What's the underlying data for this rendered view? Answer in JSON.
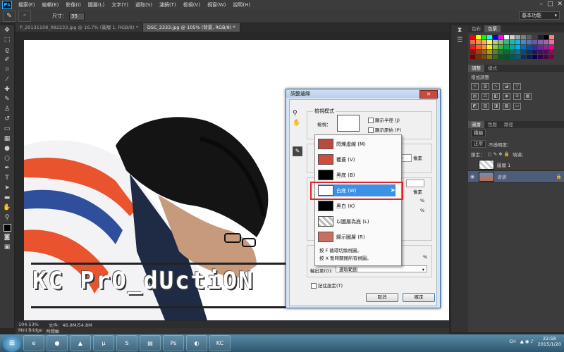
{
  "menubar": {
    "items": [
      "檔案(F)",
      "編輯(E)",
      "影像(I)",
      "圖層(L)",
      "文字(Y)",
      "選取(S)",
      "濾鏡(T)",
      "檢視(V)",
      "視窗(W)",
      "說明(H)"
    ],
    "app_icon": "Ps"
  },
  "options": {
    "size_label": "尺寸：",
    "size_value": "35",
    "workspace": "基本功能"
  },
  "tabs": [
    {
      "label": "P_20131108_082233.jpg @ 16.7% (圖層 1, RGB/8) *"
    },
    {
      "label": "DSC_2333.jpg @ 105% (背景, RGB/8) *"
    }
  ],
  "canvas": {
    "watermark": "KC PrO_dUctiON"
  },
  "status": {
    "zoom": "104.53%",
    "doc": "文件：46.8M/54.8M"
  },
  "bottom_tabs": [
    "Mini Bridge",
    "時間軸"
  ],
  "panels": {
    "color_tabs": [
      "色彩",
      "色票"
    ],
    "swatch_colors": [
      "#ff0000",
      "#ffff00",
      "#00ff00",
      "#00ffff",
      "#0000ff",
      "#ff00ff",
      "#ffffff",
      "#d0d0d0",
      "#a0a0a0",
      "#808080",
      "#606060",
      "#404040",
      "#202020",
      "#000000",
      "#ff8080",
      "#f26c4f",
      "#f68e55",
      "#fbaf5c",
      "#fff467",
      "#acd372",
      "#7cc576",
      "#3bb878",
      "#1abbb4",
      "#00bff3",
      "#438ccb",
      "#5574b9",
      "#605ca8",
      "#855fa8",
      "#a763a8",
      "#f06ea9",
      "#ed1c24",
      "#f26522",
      "#f7941d",
      "#fff200",
      "#8dc63f",
      "#39b54a",
      "#00a651",
      "#00a99d",
      "#00aeef",
      "#0072bc",
      "#0054a6",
      "#2e3192",
      "#662d91",
      "#92278f",
      "#ec008c",
      "#9e0b0f",
      "#a0410d",
      "#a36209",
      "#aba000",
      "#598527",
      "#1a7b30",
      "#007236",
      "#00746b",
      "#0076a3",
      "#004b80",
      "#003471",
      "#1b1464",
      "#440e62",
      "#630460",
      "#9e005d",
      "#790000",
      "#7b2e00",
      "#7d4900",
      "#827b00",
      "#406618",
      "#005e20",
      "#005826",
      "#005952",
      "#005b7f",
      "#003663",
      "#002157",
      "#0d004c",
      "#32004b",
      "#4b0049",
      "#7b0046"
    ],
    "adjust_tabs": [
      "調整",
      "樣式"
    ],
    "adjust_title": "增加調整",
    "layer_tabs": [
      "圖層",
      "色版",
      "路徑"
    ],
    "layer_kind": "種類",
    "blend_mode": "正常",
    "opacity_label": "不透明度：",
    "lock_label": "鎖定：",
    "fill_label": "填滿：",
    "layers": [
      {
        "name": "圖層 1"
      },
      {
        "name": "背景"
      }
    ]
  },
  "dialog": {
    "title": "調整邊緣",
    "view_mode_legend": "檢視模式",
    "view_label": "檢視：",
    "show_radius": "顯示半徑 (J)",
    "show_original": "顯示原始 (P)",
    "unit_px_1": "像素",
    "unit_px_2": "像素",
    "unit_pct_1": "%",
    "unit_pct_2": "%",
    "num_fragment": "6",
    "output_to": "輸出至(O):",
    "output_value": "選取範圍",
    "remember": "記住設定(T)",
    "cancel": "取消",
    "ok": "確定"
  },
  "dropdown": {
    "items": [
      {
        "label": "閃爍虛線 (M)",
        "thumb": "#b94a3c"
      },
      {
        "label": "覆蓋 (V)",
        "thumb": "#d24a3a"
      },
      {
        "label": "黑底 (B)",
        "thumb": "#000000"
      },
      {
        "label": "白底 (W)",
        "thumb": "#ffffff"
      },
      {
        "label": "黑白 (K)",
        "thumb": "#000000"
      },
      {
        "label": "以圖層為底 (L)",
        "thumb": "#bbbbbb"
      },
      {
        "label": "顯示圖層 (R)",
        "thumb": "#c9715e"
      }
    ],
    "help1": "按 F 循環切換視圖。",
    "help2": "按 X 暫時關閉所有視圖。"
  },
  "taskbar": {
    "icons": [
      "ie-icon",
      "chrome-icon",
      "vlc-icon",
      "utorrent-icon",
      "skype-icon",
      "explorer-icon",
      "photoshop-icon",
      "app-icon",
      "kc-icon"
    ],
    "labels": [
      "e",
      "●",
      "▲",
      "µ",
      "S",
      "▤",
      "Ps",
      "◐",
      "KC"
    ],
    "lang": "CH",
    "time": "22:58",
    "date": "2015/1/20"
  }
}
